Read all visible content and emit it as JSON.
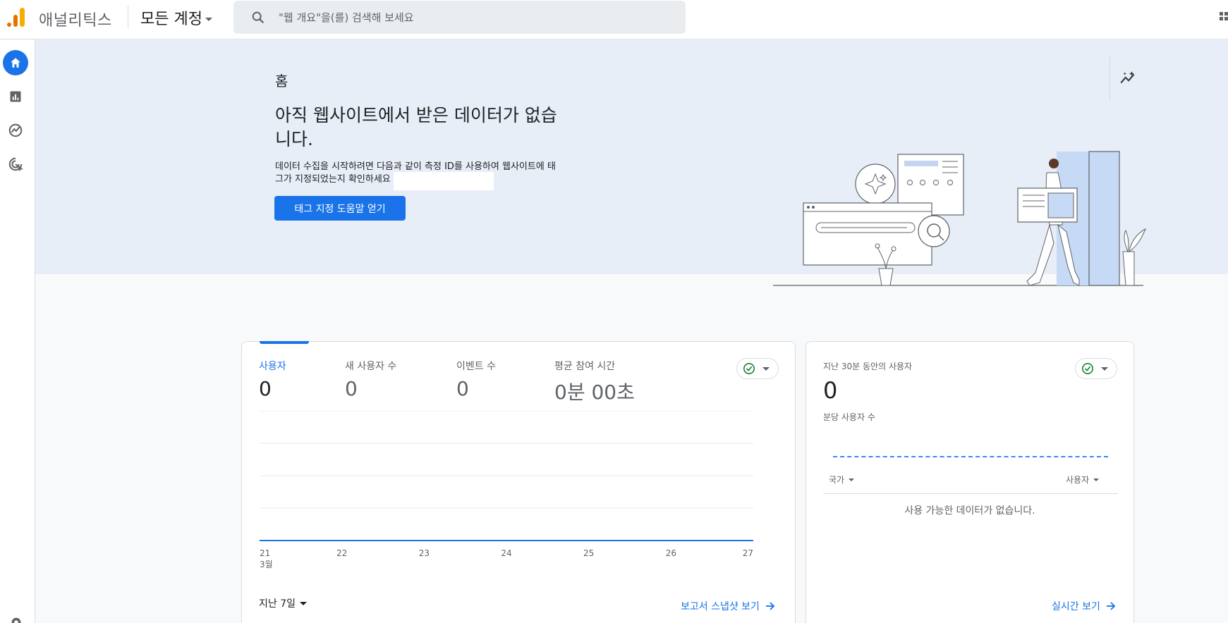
{
  "header": {
    "app_name": "애널리틱스",
    "account_selector": "모든 계정",
    "search_placeholder": "\"웹 개요\"을(를) 검색해 보세요"
  },
  "leftnav": {
    "items": [
      {
        "name": "home",
        "icon": "home-icon",
        "active": true
      },
      {
        "name": "reports",
        "icon": "bar-chart-icon"
      },
      {
        "name": "explore",
        "icon": "explore-icon"
      },
      {
        "name": "advertising",
        "icon": "target-icon"
      }
    ]
  },
  "hero": {
    "page_title": "홈",
    "headline": "아직 웹사이트에서 받은 데이터가 없습니다.",
    "description": "데이터 수집을 시작하려면 다음과 같이 측정 ID를 사용하여 웹사이트에 태그가 지정되었는지 확인하세요",
    "cta_label": "태그 지정 도움말 얻기"
  },
  "overview": {
    "metrics": [
      {
        "label": "사용자",
        "value": "0"
      },
      {
        "label": "새 사용자 수",
        "value": "0"
      },
      {
        "label": "이벤트 수",
        "value": "0"
      },
      {
        "label": "평균 참여 시간",
        "value": "0분 00초"
      }
    ],
    "range_label": "지난 7일",
    "snapshot_link": "보고서 스냅샷 보기"
  },
  "chart_data": {
    "type": "line",
    "x": [
      "21",
      "22",
      "23",
      "24",
      "25",
      "26",
      "27"
    ],
    "x_sublabel": "3월",
    "series": [
      {
        "values": [
          0,
          0,
          0,
          0,
          0,
          0,
          0
        ]
      }
    ],
    "grid": true,
    "color": "#1a73e8"
  },
  "realtime": {
    "title": "지난 30분 동안의 사용자",
    "value": "0",
    "subtitle": "분당 사용자 수",
    "col_country": "국가",
    "col_users": "사용자",
    "empty_text": "사용 가능한 데이터가 없습니다.",
    "link": "실시간 보기"
  },
  "colors": {
    "accent": "#1a73e8",
    "hero_bg": "#e8eef8",
    "status_green": "#188038"
  }
}
